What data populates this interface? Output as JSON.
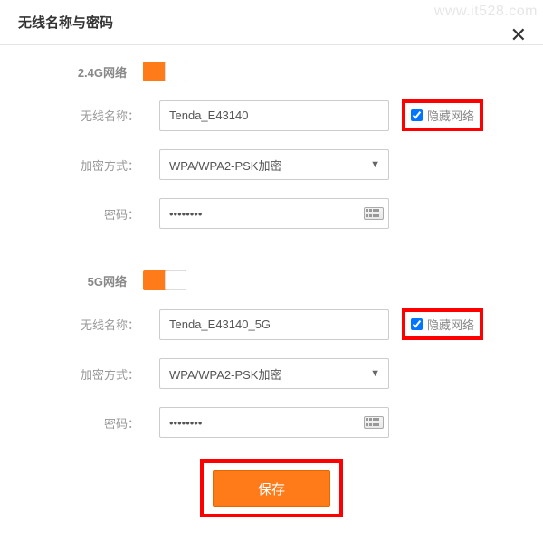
{
  "header": {
    "title": "无线名称与密码",
    "watermark": "www.it528.com"
  },
  "section24": {
    "title": "2.4G网络",
    "name_label": "无线名称：",
    "name_value": "Tenda_E43140",
    "hide_label": "隐藏网络",
    "encrypt_label": "加密方式：",
    "encrypt_value": "WPA/WPA2-PSK加密",
    "password_label": "密码：",
    "password_value": "••••••••"
  },
  "section5g": {
    "title": "5G网络",
    "name_label": "无线名称：",
    "name_value": "Tenda_E43140_5G",
    "hide_label": "隐藏网络",
    "encrypt_label": "加密方式：",
    "encrypt_value": "WPA/WPA2-PSK加密",
    "password_label": "密码：",
    "password_value": "••••••••"
  },
  "footer": {
    "save_label": "保存"
  }
}
